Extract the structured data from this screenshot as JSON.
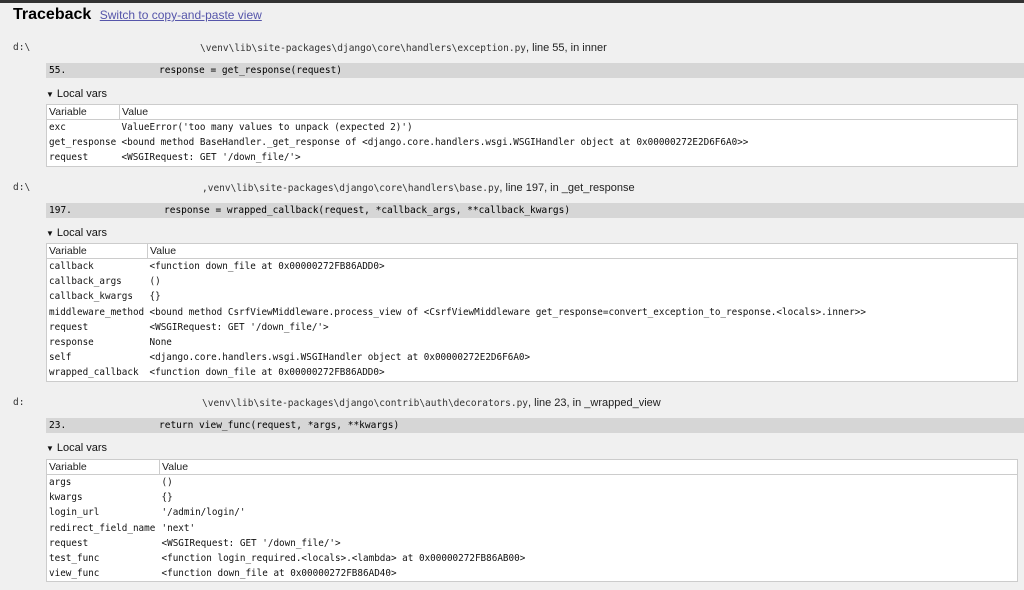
{
  "header": {
    "title": "Traceback",
    "switch_link": "Switch to copy-and-paste view"
  },
  "frames": [
    {
      "drive": "d:\\",
      "path": "\\venv\\lib\\site-packages\\django\\core\\handlers\\exception.py",
      "location": ", line 55, in inner",
      "lineno": "55.",
      "code": "response = get_response(request)",
      "vars_label": "Local vars",
      "var_header": "Variable",
      "val_header": "Value",
      "vars": [
        {
          "name": "exc",
          "value": "ValueError('too many values to unpack (expected 2)')"
        },
        {
          "name": "get_response",
          "value": "<bound method BaseHandler._get_response of <django.core.handlers.wsgi.WSGIHandler object at 0x00000272E2D6F6A0>>"
        },
        {
          "name": "request",
          "value": "<WSGIRequest: GET '/down_file/'>"
        }
      ]
    },
    {
      "drive": "d:\\",
      "path": ",venv\\lib\\site-packages\\django\\core\\handlers\\base.py",
      "location": ", line 197, in _get_response",
      "lineno": "197.",
      "code": "response = wrapped_callback(request, *callback_args, **callback_kwargs)",
      "vars_label": "Local vars",
      "var_header": "Variable",
      "val_header": "Value",
      "vars": [
        {
          "name": "callback",
          "value": "<function down_file at 0x00000272FB86ADD0>"
        },
        {
          "name": "callback_args",
          "value": "()"
        },
        {
          "name": "callback_kwargs",
          "value": "{}"
        },
        {
          "name": "middleware_method",
          "value": "<bound method CsrfViewMiddleware.process_view of <CsrfViewMiddleware get_response=convert_exception_to_response.<locals>.inner>>"
        },
        {
          "name": "request",
          "value": "<WSGIRequest: GET '/down_file/'>"
        },
        {
          "name": "response",
          "value": "None"
        },
        {
          "name": "self",
          "value": "<django.core.handlers.wsgi.WSGIHandler object at 0x00000272E2D6F6A0>"
        },
        {
          "name": "wrapped_callback",
          "value": "<function down_file at 0x00000272FB86ADD0>"
        }
      ]
    },
    {
      "drive": "d:",
      "path": "\\venv\\lib\\site-packages\\django\\contrib\\auth\\decorators.py",
      "location": ", line 23, in _wrapped_view",
      "lineno": "23.",
      "code": "return view_func(request, *args, **kwargs)",
      "vars_label": "Local vars",
      "var_header": "Variable",
      "val_header": "Value",
      "vars": [
        {
          "name": "args",
          "value": "()"
        },
        {
          "name": "kwargs",
          "value": "{}"
        },
        {
          "name": "login_url",
          "value": "'/admin/login/'"
        },
        {
          "name": "redirect_field_name",
          "value": "'next'"
        },
        {
          "name": "request",
          "value": "<WSGIRequest: GET '/down_file/'>"
        },
        {
          "name": "test_func",
          "value": "<function login_required.<locals>.<lambda> at 0x00000272FB86AB00>"
        },
        {
          "name": "view_func",
          "value": "<function down_file at 0x00000272FB86AD40>"
        }
      ]
    }
  ]
}
